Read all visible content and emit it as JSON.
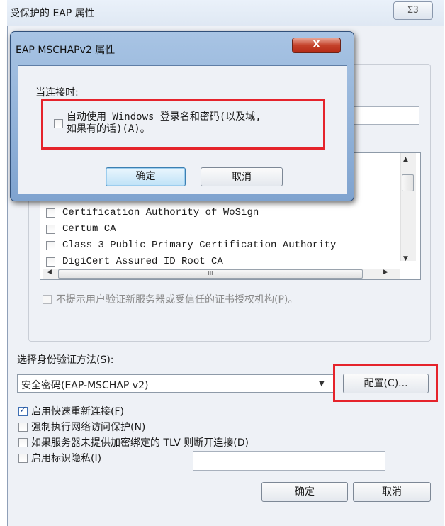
{
  "outer_dialog": {
    "title": "受保护的 EAP 属性",
    "close_glyph": "ΣЗ",
    "ca_list": [
      {
        "label": "Certification Authority of WoSign",
        "checked": false
      },
      {
        "label": "Certum CA",
        "checked": false
      },
      {
        "label": "Class 3 Public Primary Certification Authority",
        "checked": false
      },
      {
        "label": "DigiCert Assured ID Root CA",
        "checked": false
      }
    ],
    "hscroll_grip": "III",
    "no_prompt_label": "不提示用户验证新服务器或受信任的证书授权机构(P)。",
    "auth_method_label": "选择身份验证方法(S):",
    "auth_method_value": "安全密码(EAP-MSCHAP v2)",
    "configure_button": "配置(C)...",
    "options": [
      {
        "label": "启用快速重新连接(F)",
        "checked": true
      },
      {
        "label": "强制执行网络访问保护(N)",
        "checked": false
      },
      {
        "label": "如果服务器未提供加密绑定的 TLV 则断开连接(D)",
        "checked": false
      },
      {
        "label": "启用标识隐私(I)",
        "checked": false
      }
    ],
    "ok_button": "确定",
    "cancel_button": "取消"
  },
  "inner_dialog": {
    "title": "EAP MSCHAPv2 属性",
    "close_glyph": "X",
    "connect_label": "当连接时:",
    "auto_use_label": "自动使用 Windows 登录名和密码(以及域,\n如果有的话)(A)。",
    "auto_use_checked": false,
    "ok_button": "确定",
    "cancel_button": "取消"
  },
  "colors": {
    "highlight": "#e5232b",
    "dialog_bg": "#eef1f6",
    "title_glass": "#a8c4e4",
    "close_red": "#c4412a"
  }
}
